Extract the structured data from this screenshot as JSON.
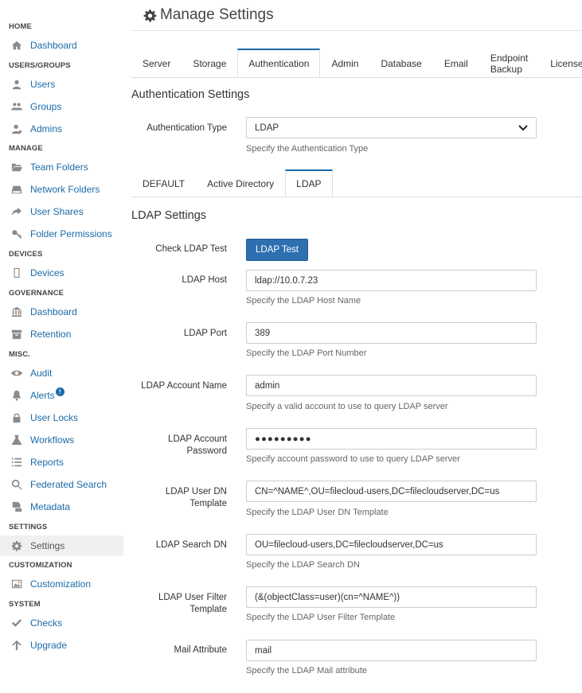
{
  "sidebar": {
    "sections": {
      "home": "HOME",
      "users_groups": "USERS/GROUPS",
      "manage": "MANAGE",
      "devices": "DEVICES",
      "governance": "GOVERNANCE",
      "misc": "MISC.",
      "settings": "SETTINGS",
      "customization": "CUSTOMIZATION",
      "system": "SYSTEM"
    },
    "items": {
      "dashboard": "Dashboard",
      "users": "Users",
      "groups": "Groups",
      "admins": "Admins",
      "team_folders": "Team Folders",
      "network_folders": "Network Folders",
      "user_shares": "User Shares",
      "folder_permissions": "Folder Permissions",
      "devices": "Devices",
      "gov_dashboard": "Dashboard",
      "retention": "Retention",
      "audit": "Audit",
      "alerts": "Alerts",
      "alerts_badge": "!",
      "user_locks": "User Locks",
      "workflows": "Workflows",
      "reports": "Reports",
      "federated_search": "Federated Search",
      "metadata": "Metadata",
      "settings": "Settings",
      "customization": "Customization",
      "checks": "Checks",
      "upgrade": "Upgrade"
    }
  },
  "header": {
    "title": "Manage Settings"
  },
  "tabs": [
    "Server",
    "Storage",
    "Authentication",
    "Admin",
    "Database",
    "Email",
    "Endpoint Backup",
    "License"
  ],
  "auth": {
    "section_title": "Authentication Settings",
    "type_label": "Authentication Type",
    "type_value": "LDAP",
    "type_help": "Specify the Authentication Type"
  },
  "subtabs": [
    "DEFAULT",
    "Active Directory",
    "LDAP"
  ],
  "ldap": {
    "section_title": "LDAP Settings",
    "check_label": "Check LDAP Test",
    "test_button": "LDAP Test",
    "host_label": "LDAP Host",
    "host_value": "ldap://10.0.7.23",
    "host_help": "Specify the LDAP Host Name",
    "port_label": "LDAP Port",
    "port_value": "389",
    "port_help": "Specify the LDAP Port Number",
    "account_label": "LDAP Account Name",
    "account_value": "admin",
    "account_help": "Specify a valid account to use to query LDAP server",
    "password_label": "LDAP Account Password",
    "password_value": "●●●●●●●●●",
    "password_help": "Specify account password to use to query LDAP server",
    "userdn_label": "LDAP User DN Template",
    "userdn_value": "CN=^NAME^,OU=filecloud-users,DC=filecloudserver,DC=us",
    "userdn_help": "Specify the LDAP User DN Template",
    "searchdn_label": "LDAP Search DN",
    "searchdn_value": "OU=filecloud-users,DC=filecloudserver,DC=us",
    "searchdn_help": "Specify the LDAP Search DN",
    "filter_label": "LDAP User Filter Template",
    "filter_value": "(&(objectClass=user)(cn=^NAME^))",
    "filter_help": "Specify the LDAP User Filter Template",
    "mail_label": "Mail Attribute",
    "mail_value": "mail",
    "mail_help": "Specify the LDAP Mail attribute"
  }
}
